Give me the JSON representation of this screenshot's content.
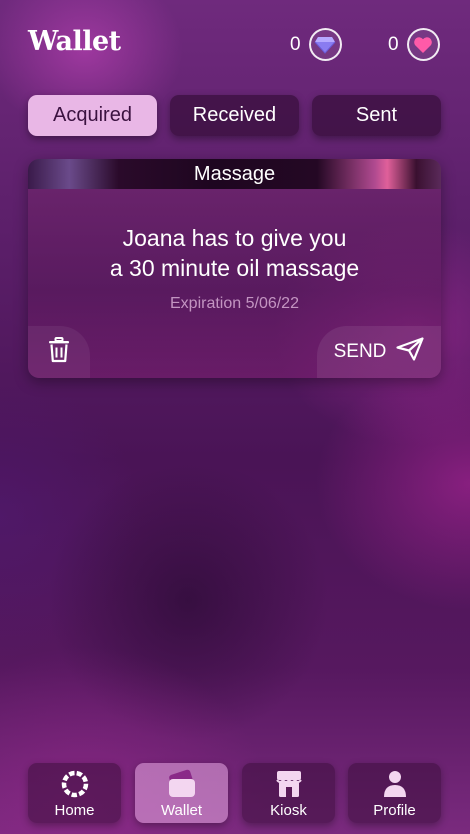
{
  "header": {
    "title": "Wallet",
    "gems": {
      "count": "0",
      "icon": "diamond-icon",
      "color": "#8a7cf0"
    },
    "hearts": {
      "count": "0",
      "icon": "heart-icon",
      "color": "#ff5aa8"
    }
  },
  "tabs": [
    {
      "label": "Acquired",
      "active": true
    },
    {
      "label": "Received",
      "active": false
    },
    {
      "label": "Sent",
      "active": false
    }
  ],
  "card": {
    "title": "Massage",
    "message_line1": "Joana has to give you",
    "message_line2": "a 30 minute oil massage",
    "expiration": "Expiration 5/06/22",
    "send_label": "SEND",
    "delete_icon": "trash-icon",
    "send_icon": "paper-plane-icon"
  },
  "nav": [
    {
      "label": "Home",
      "icon": "ring-icon",
      "active": false
    },
    {
      "label": "Wallet",
      "icon": "wallet-icon",
      "active": true
    },
    {
      "label": "Kiosk",
      "icon": "store-icon",
      "active": false
    },
    {
      "label": "Profile",
      "icon": "person-icon",
      "active": false
    }
  ],
  "colors": {
    "active_tab_bg": "#e9b7e6",
    "active_tab_text": "#3b1240"
  }
}
